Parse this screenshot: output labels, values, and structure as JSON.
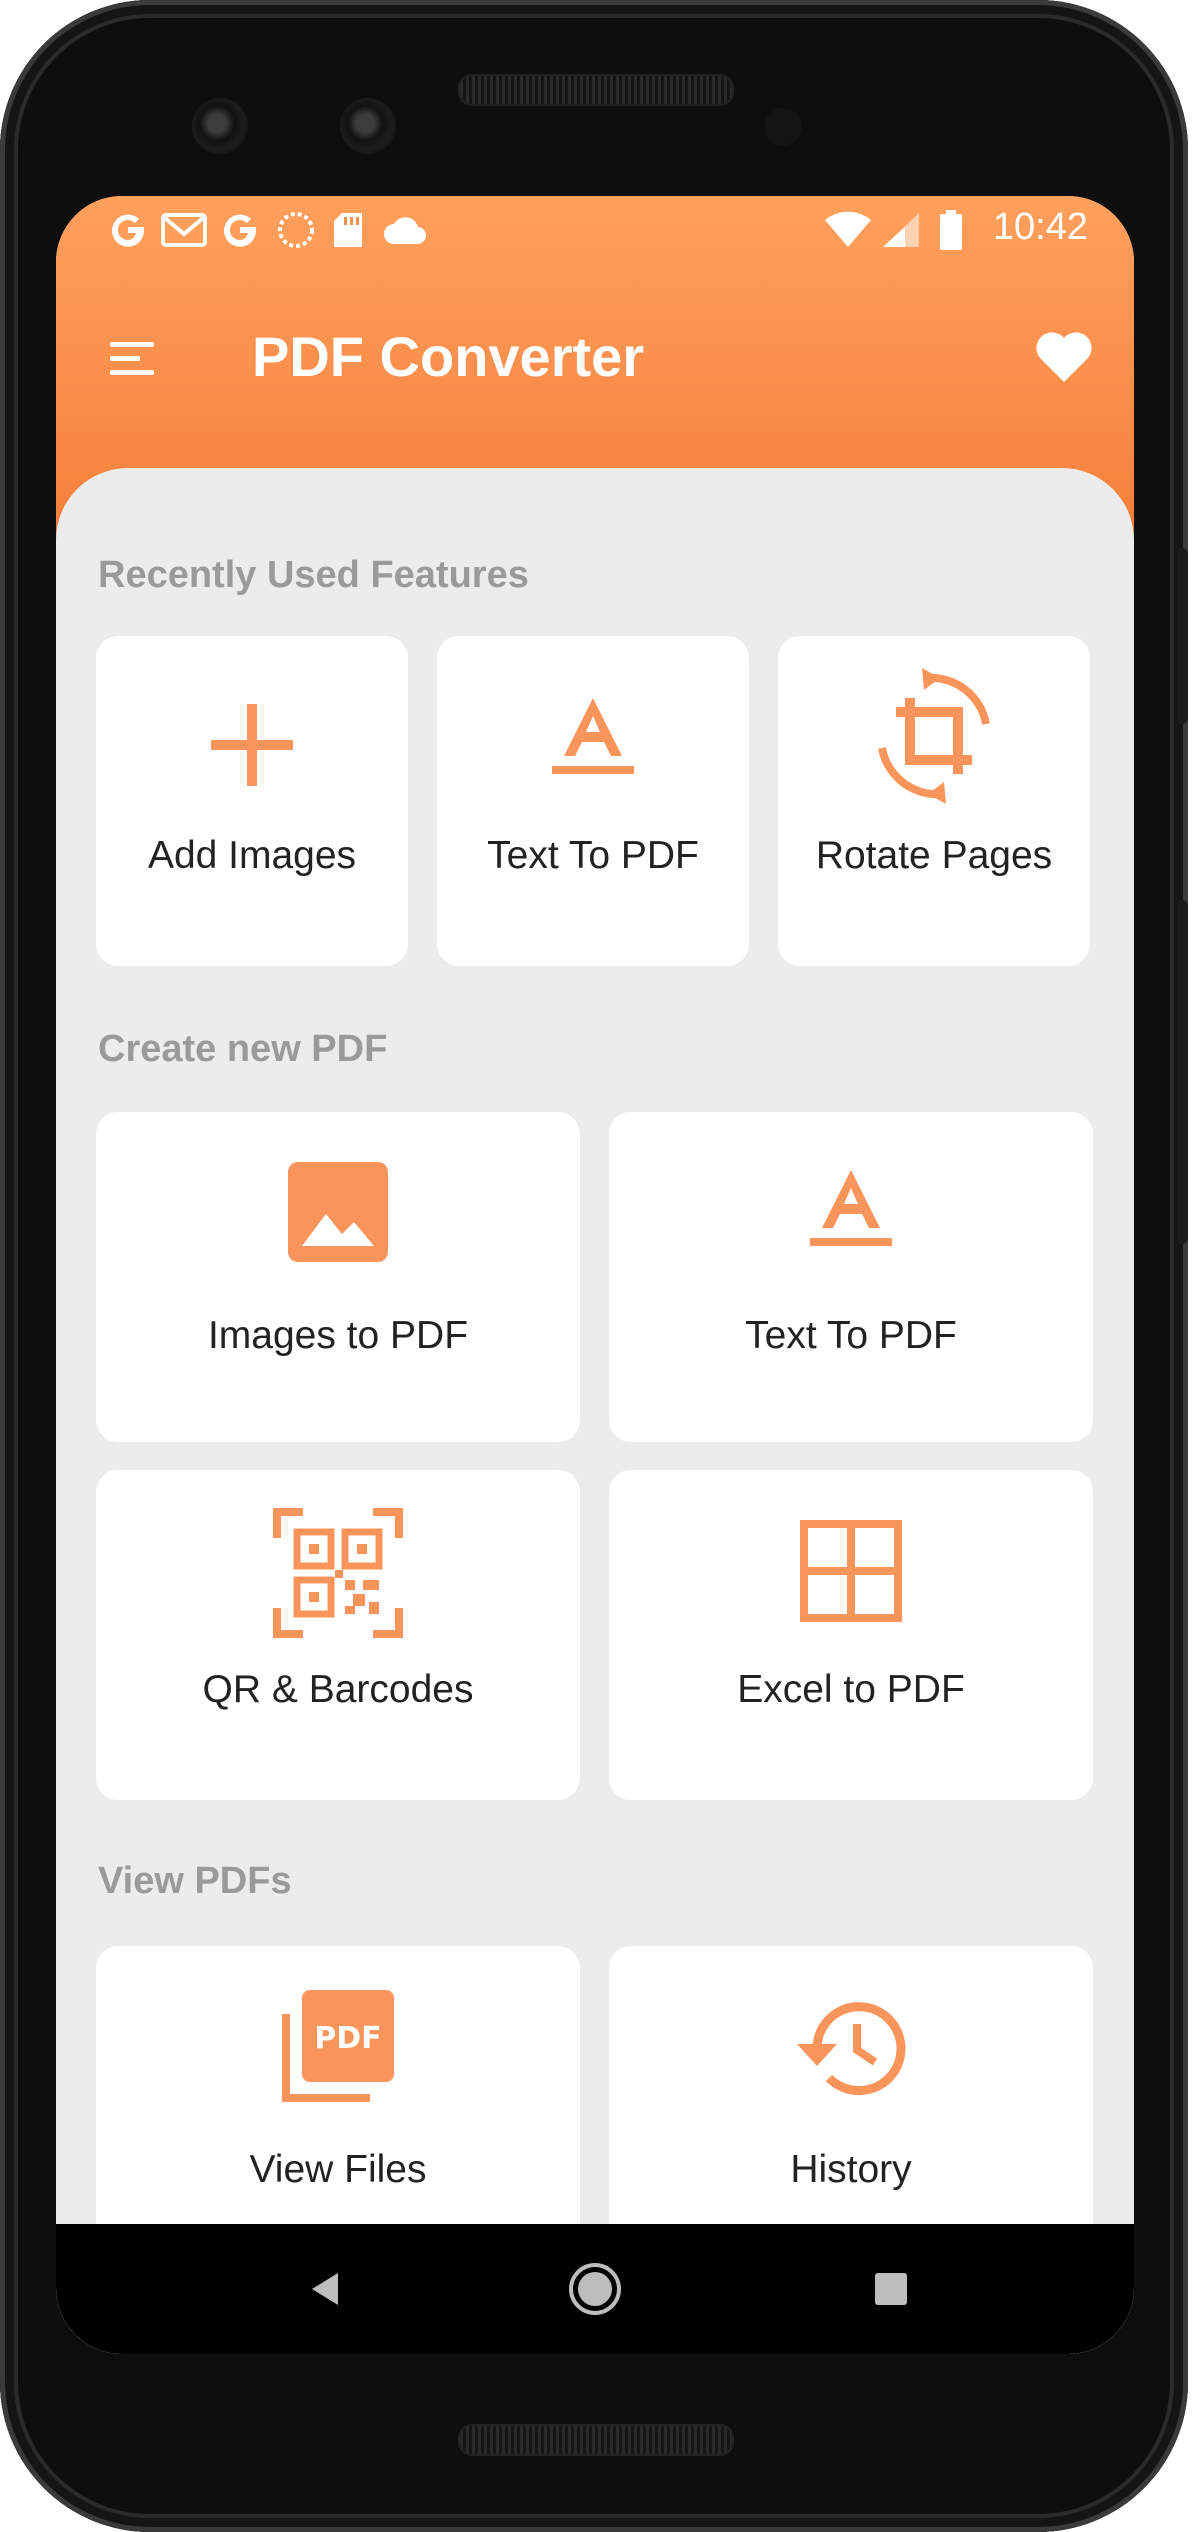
{
  "status_bar": {
    "left_icons": [
      "google-icon",
      "gmail-icon",
      "google-icon",
      "sync-icon",
      "sd-card-icon",
      "cloud-icon"
    ],
    "right_icons": [
      "wifi-icon",
      "signal-icon",
      "battery-icon"
    ],
    "time": "10:42"
  },
  "app_bar": {
    "title": "PDF Converter",
    "menu_icon": "menu-icon",
    "favorite_icon": "heart-icon"
  },
  "colors": {
    "accent": "#f9955a",
    "header_top": "#ffa05c",
    "header_bottom": "#f47a34",
    "background": "#ececec",
    "card": "#ffffff",
    "section_title": "#9a9a9a"
  },
  "sections": {
    "recent": {
      "title": "Recently Used Features",
      "items": [
        {
          "label": "Add Images",
          "icon": "plus-icon"
        },
        {
          "label": "Text To PDF",
          "icon": "text-format-icon"
        },
        {
          "label": "Rotate Pages",
          "icon": "crop-rotate-icon"
        }
      ]
    },
    "create": {
      "title": "Create new PDF",
      "items": [
        {
          "label": "Images to PDF",
          "icon": "image-icon"
        },
        {
          "label": "Text To PDF",
          "icon": "text-format-icon"
        },
        {
          "label": "QR & Barcodes",
          "icon": "qr-scan-icon"
        },
        {
          "label": "Excel to PDF",
          "icon": "grid-icon"
        }
      ]
    },
    "view": {
      "title": "View PDFs",
      "items": [
        {
          "label": "View Files",
          "icon": "pdf-file-icon"
        },
        {
          "label": "History",
          "icon": "history-icon"
        }
      ]
    }
  },
  "nav_bar": {
    "back_icon": "back-triangle-icon",
    "home_icon": "home-circle-icon",
    "recents_icon": "recents-square-icon"
  }
}
